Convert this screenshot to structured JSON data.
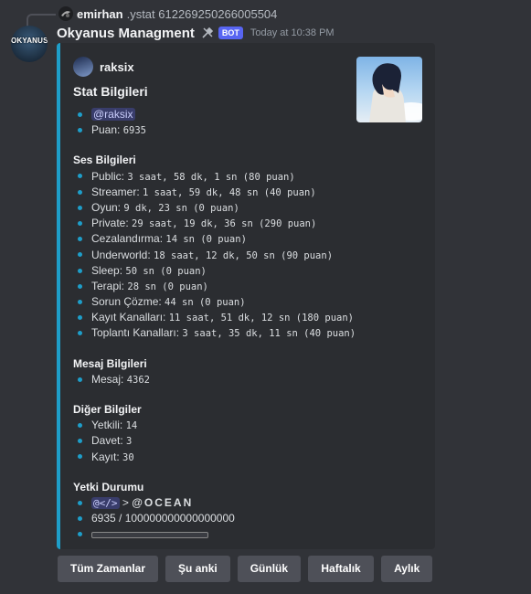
{
  "reply": {
    "name": "emirhan",
    "content": ".ystat 612269250266005504"
  },
  "message": {
    "bot_name": "Okyanus Managment",
    "bot_tag": "BOT",
    "timestamp": "Today at 10:38 PM",
    "avatar_text": "OKYANUS"
  },
  "embed": {
    "accent_color": "#1e9ec9",
    "author_name": "raksix",
    "title": "Stat Bilgileri",
    "user_mention": "@raksix",
    "puan_label": "Puan:",
    "puan_value": "6935",
    "ses": {
      "heading": "Ses Bilgileri",
      "items": [
        {
          "label": "Public:",
          "value": "3 saat, 58 dk, 1 sn (80 puan)"
        },
        {
          "label": "Streamer:",
          "value": "1 saat, 59 dk, 48 sn (40 puan)"
        },
        {
          "label": "Oyun:",
          "value": "9 dk, 23 sn (0 puan)"
        },
        {
          "label": "Private:",
          "value": "29 saat, 19 dk, 36 sn (290 puan)"
        },
        {
          "label": "Cezalandırma:",
          "value": "14 sn (0 puan)"
        },
        {
          "label": "Underworld:",
          "value": "18 saat, 12 dk, 50 sn (90 puan)"
        },
        {
          "label": "Sleep:",
          "value": "50 sn (0 puan)"
        },
        {
          "label": "Terapi:",
          "value": "28 sn (0 puan)"
        },
        {
          "label": "Sorun Çözme:",
          "value": "44 sn (0 puan)"
        },
        {
          "label": "Kayıt Kanalları:",
          "value": "11 saat, 51 dk, 12 sn (180 puan)"
        },
        {
          "label": "Toplantı Kanalları:",
          "value": "3 saat, 35 dk, 11 sn (40 puan)"
        }
      ]
    },
    "mesaj": {
      "heading": "Mesaj Bilgileri",
      "items": [
        {
          "label": "Mesaj:",
          "value": "4362"
        }
      ]
    },
    "diger": {
      "heading": "Diğer Bilgiler",
      "items": [
        {
          "label": "Yetkili:",
          "value": "14"
        },
        {
          "label": "Davet:",
          "value": "3"
        },
        {
          "label": "Kayıt:",
          "value": "30"
        }
      ]
    },
    "yetki": {
      "heading": "Yetki Durumu",
      "role_mention": "@</>",
      "arrow": ">",
      "target_role": "@OCEAN",
      "progress_text": "6935 / 100000000000000000",
      "progress_fraction": 0.0
    }
  },
  "buttons": [
    "Tüm Zamanlar",
    "Şu anki",
    "Günlük",
    "Haftalık",
    "Aylık"
  ]
}
